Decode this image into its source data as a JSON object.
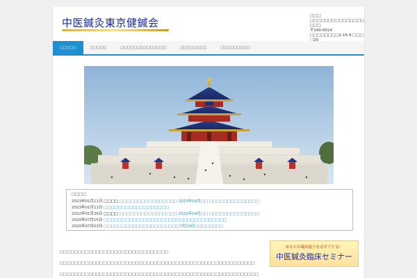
{
  "header": {
    "site_title": "中医鍼灸東京健鍼会",
    "address_lines": [
      "□□□",
      "□□□□□□□□□□□□□□□□□□",
      "〒140-0014",
      "□□□□□□□□1-15-4 □□□□20"
    ]
  },
  "nav": {
    "items": [
      {
        "label": "□□□□□",
        "active": true
      },
      {
        "label": "□□□□□",
        "active": false
      },
      {
        "label": "□□□□□□□□□□□□□□",
        "active": false
      },
      {
        "label": "□□□□□□□□",
        "active": false
      },
      {
        "label": "□□□□□□□□□",
        "active": false
      }
    ]
  },
  "hero": {
    "image_name": "temple-of-heaven-photo"
  },
  "news": {
    "heading": "□□□□",
    "items": [
      {
        "date": "2023年01月11日",
        "parts": [
          {
            "text": "□□□□",
            "link": false
          },
          {
            "text": "□□□□□□□□□□□□□□□□ 2023年04月□□",
            "link": true
          },
          {
            "text": "□□□□□□□□□□□□□□",
            "link": true
          }
        ]
      },
      {
        "date": "2023年01月11日",
        "parts": [
          {
            "text": "□□□□□□□□□□□□□□□□□□",
            "link": true
          }
        ]
      },
      {
        "date": "2022年01月26日",
        "parts": [
          {
            "text": "□□□□",
            "link": false
          },
          {
            "text": "□□□□□□□□□□□□□□□□ 2022年04月□□",
            "link": true
          },
          {
            "text": "□□□□□□□□□□□□□□",
            "link": true
          }
        ]
      },
      {
        "date": "2020年07月15日",
        "parts": [
          {
            "text": "□□□□□□□□□□□□□□□□□□□□□□□□□□□□□□□□□□",
            "link": true
          }
        ]
      },
      {
        "date": "2020年07月03日",
        "parts": [
          {
            "text": "□□□□□□□□□□□□□□□□□□□□□7月19日□□□□□□□□",
            "link": true
          }
        ]
      }
    ]
  },
  "body": {
    "paragraphs": [
      "□□□□□□□□□□□□□□□□□□□□□□□□□□□□□□",
      "□□□□□□□□□□□□□□□□□□□□□□□□□□□□□□□□□□□□□□□□□□□□□□□□□□□□□□",
      "□□□□□□□□□□□□□□□□□□□□□□□□□□□□□□□□□□□□□□□□□□□□□□□□□□□□□□□"
    ]
  },
  "banner": {
    "top_text": "あなたの臨床能力を必ずアゲる！",
    "main_text": "中医鍼灸臨床セミナー"
  },
  "colors": {
    "accent": "#1e8fd3",
    "title": "#1a2a9a",
    "link": "#1e8fd3",
    "banner_text": "#1c2fa3"
  }
}
